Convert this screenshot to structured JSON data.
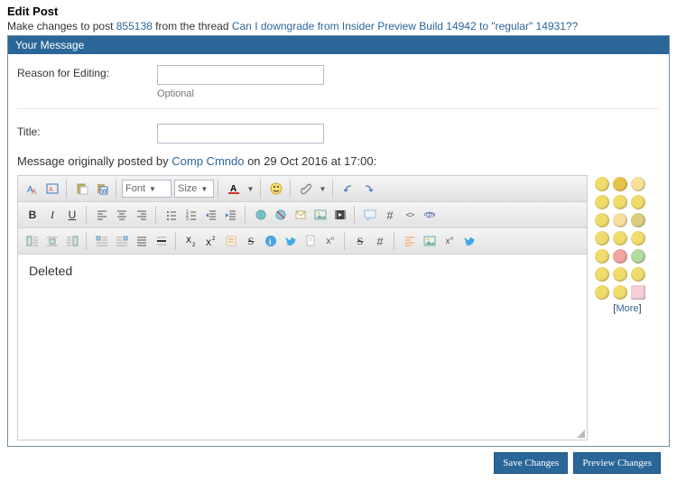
{
  "header": {
    "title": "Edit Post",
    "sub_pre": "Make changes to post ",
    "post_id": "855138",
    "sub_mid": " from the thread ",
    "thread_title": "Can I downgrade from Insider Preview Build 14942 to \"regular\" 14931??"
  },
  "panel": {
    "heading": "Your Message"
  },
  "fields": {
    "reason_label": "Reason for Editing:",
    "reason_value": "",
    "reason_hint": "Optional",
    "title_label": "Title:",
    "title_value": ""
  },
  "meta": {
    "pre": "Message originally posted by ",
    "author": "Comp Cmndo",
    "post": " on 29 Oct 2016 at 17:00:"
  },
  "toolbar": {
    "font_placeholder": "Font",
    "size_placeholder": "Size"
  },
  "editor": {
    "content": "Deleted"
  },
  "smilies": {
    "more_pre": "[",
    "more": "More",
    "more_post": "]",
    "colors": [
      "#f0dc6c",
      "#e8c44b",
      "#f4e29a",
      "#f0dc6c",
      "#f0dc6c",
      "#f0dc6c",
      "#f0dc6c",
      "#f4dfa0",
      "#d9cf7d",
      "#f0dc6c",
      "#f0dc6c",
      "#f0dc6c",
      "#f0dc6c",
      "#f2a4a0",
      "#b4daa0",
      "#f0dc6c",
      "#f0dc6c",
      "#f0dc6c",
      "#f0dc6c",
      "#f0dc6c",
      "#f6ced6"
    ]
  },
  "footer": {
    "save": "Save Changes",
    "preview": "Preview Changes"
  }
}
